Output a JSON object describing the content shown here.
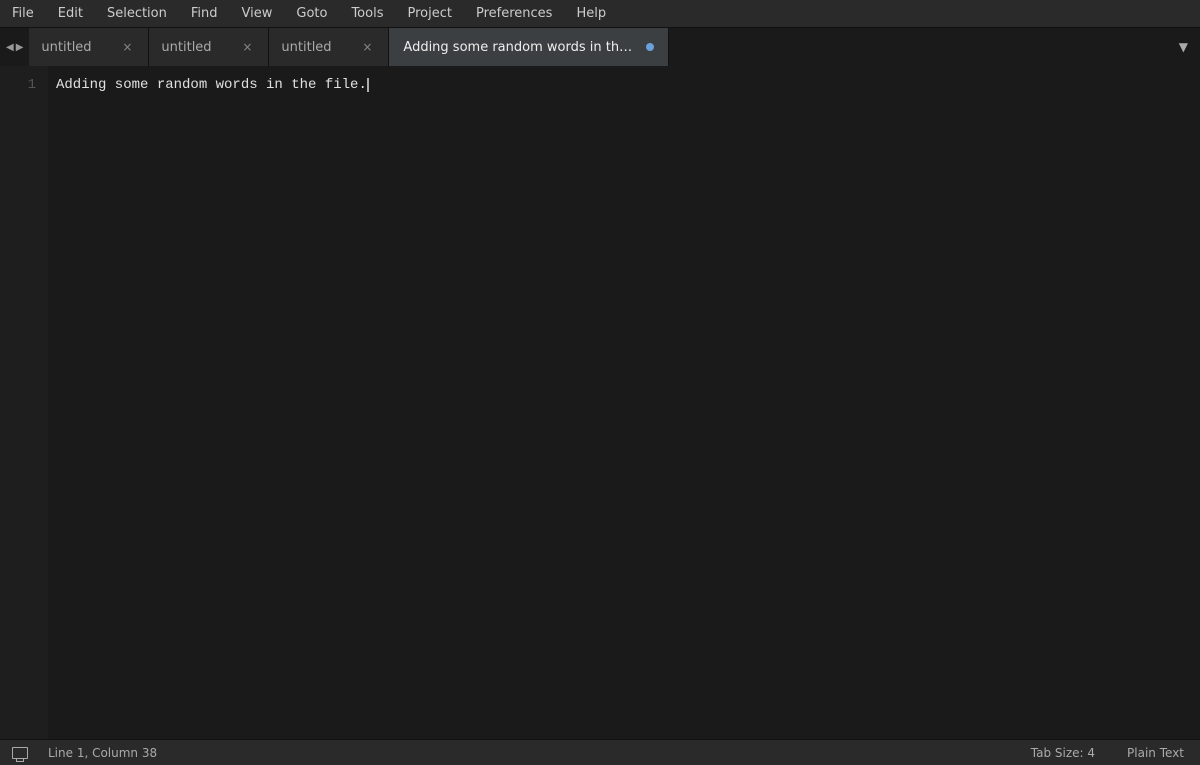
{
  "menubar": {
    "items": [
      "File",
      "Edit",
      "Selection",
      "Find",
      "View",
      "Goto",
      "Tools",
      "Project",
      "Preferences",
      "Help"
    ]
  },
  "tabs": {
    "nav_left": "◀",
    "nav_right": "▶",
    "list": [
      {
        "label": "untitled",
        "active": false,
        "modified": false
      },
      {
        "label": "untitled",
        "active": false,
        "modified": false
      },
      {
        "label": "untitled",
        "active": false,
        "modified": false
      }
    ],
    "active_tab": {
      "label": "Adding some random words in the file.",
      "modified": true,
      "dot": "●"
    },
    "dropdown_arrow": "▼"
  },
  "editor": {
    "lines": [
      {
        "number": "1",
        "content": "Adding some random words in the file."
      }
    ]
  },
  "statusbar": {
    "position": "Line 1, Column 38",
    "tab_size": "Tab Size: 4",
    "syntax": "Plain Text"
  }
}
